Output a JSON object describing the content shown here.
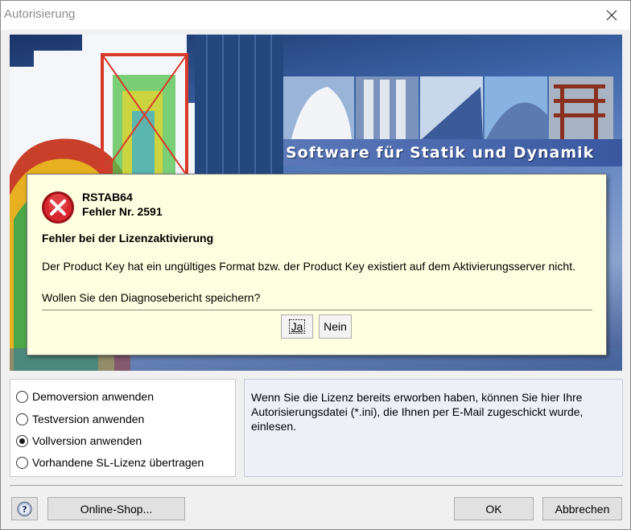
{
  "window": {
    "title": "Autorisierung"
  },
  "banner": {
    "slogan": "Software für Statik und Dynamik"
  },
  "error_dialog": {
    "program": "RSTAB64",
    "error_number": "Fehler Nr. 2591",
    "heading": "Fehler bei der Lizenzaktivierung",
    "message": "Der Product Key hat ein ungültiges Format bzw. der Product Key existiert auf dem Aktivierungsserver nicht.",
    "question": "Wollen Sie den Diagnosebericht speichern?",
    "yes_label": "Ja",
    "no_label": "Nein"
  },
  "options": [
    {
      "label": "Demoversion anwenden",
      "checked": false
    },
    {
      "label": "Testversion anwenden",
      "checked": false
    },
    {
      "label": "Vollversion anwenden",
      "checked": true
    },
    {
      "label": "Vorhandene SL-Lizenz übertragen",
      "checked": false
    }
  ],
  "info_text": "Wenn Sie die Lizenz bereits erworben haben, können Sie hier Ihre Autorisierungsdatei (*.ini), die Ihnen per E-Mail zugeschickt wurde, einlesen.",
  "footer": {
    "help_icon": "help-icon",
    "shop_label": "Online-Shop...",
    "ok_label": "OK",
    "cancel_label": "Abbrechen"
  },
  "colors": {
    "error_dialog_bg": "#fefee0",
    "error_icon": "#c0161e",
    "info_panel_bg": "#eef0f8"
  }
}
